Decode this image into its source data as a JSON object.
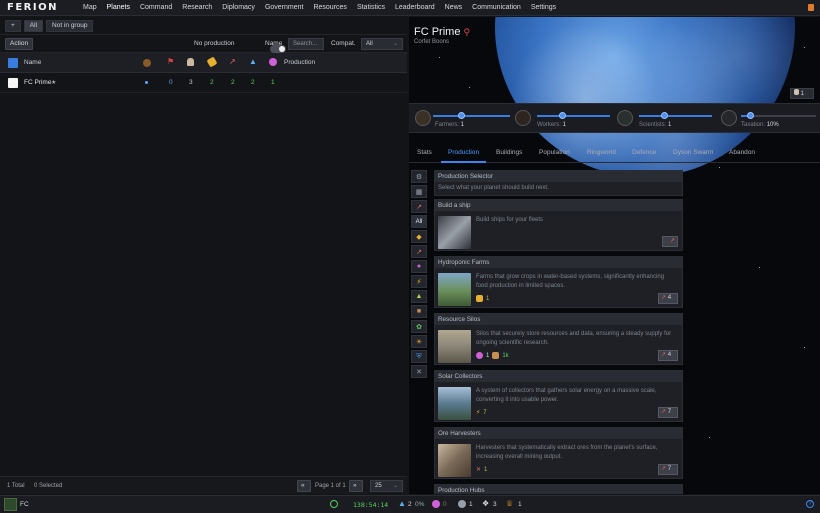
{
  "app": {
    "logo": "FERION"
  },
  "nav": [
    "Map",
    "Planets",
    "Command",
    "Research",
    "Diplomacy",
    "Government",
    "Resources",
    "Statistics",
    "Leaderboard",
    "News",
    "Communication",
    "Settings"
  ],
  "filters": {
    "add": "+",
    "all": "All",
    "not_in_group": "Not in group"
  },
  "actions": {
    "action": "Action",
    "no_production": "No production",
    "name_label": "Name",
    "search_placeholder": "Search...",
    "compat_label": "Compat.",
    "compat_value": "All"
  },
  "table": {
    "col_name": "Name",
    "col_production": "Production",
    "rows": [
      {
        "name": "FC Prime",
        "star": "★",
        "c1": "0",
        "c2": "3",
        "c3": "2",
        "c4": "2",
        "c5": "2",
        "c6": "1"
      }
    ]
  },
  "left_footer": {
    "total": "1 Total",
    "selected": "0 Selected",
    "page": "Page 1 of 1",
    "per_page": "25"
  },
  "planet": {
    "name": "FC Prime",
    "owner": "Corfet Boons",
    "farmers_label": "Farmers:",
    "farmers": "1",
    "workers_label": "Workers:",
    "workers": "1",
    "scientists_label": "Scientists:",
    "scientists": "1",
    "taxation_label": "Taxation:",
    "taxation": "10%",
    "pop_badge": "1"
  },
  "tabs": [
    "Stats",
    "Production",
    "Buildings",
    "Population",
    "Ringworld",
    "Defence",
    "Dyson Swarm",
    "Abandon"
  ],
  "production": {
    "selector": {
      "title": "Production Selector",
      "desc": "Select what your planet should build next."
    },
    "items": [
      {
        "title": "Build a ship",
        "desc": "Build ships for your fleets",
        "cost": "",
        "button": ""
      },
      {
        "title": "Hydroponic Farms",
        "desc": "Farms that grow crops in water-based systems, significantly enhancing food production in limited spaces.",
        "cost": "1",
        "button": "4"
      },
      {
        "title": "Resource Silos",
        "desc": "Silos that securely store resources and data, ensuring a steady supply for ongoing scientific research.",
        "cost": "1",
        "cost2": "1k",
        "button": "4"
      },
      {
        "title": "Solar Collectors",
        "desc": "A system of collectors that gathers solar energy on a massive scale, converting it into usable power.",
        "cost": "7",
        "button": "7"
      },
      {
        "title": "Ore Harvesters",
        "desc": "Harvesters that systematically extract ores from the planet's surface, increasing overall mining output.",
        "cost": "1",
        "button": "7"
      },
      {
        "title": "Production Hubs"
      }
    ]
  },
  "status": {
    "planet": "FC",
    "clock": "138:54:14",
    "pop": "2",
    "pop_pct": "0%",
    "res1": "0",
    "res2": "1",
    "res3": "3",
    "res4": "1"
  },
  "colors": {
    "accent": "#3b86f0",
    "bg": "#141519"
  }
}
